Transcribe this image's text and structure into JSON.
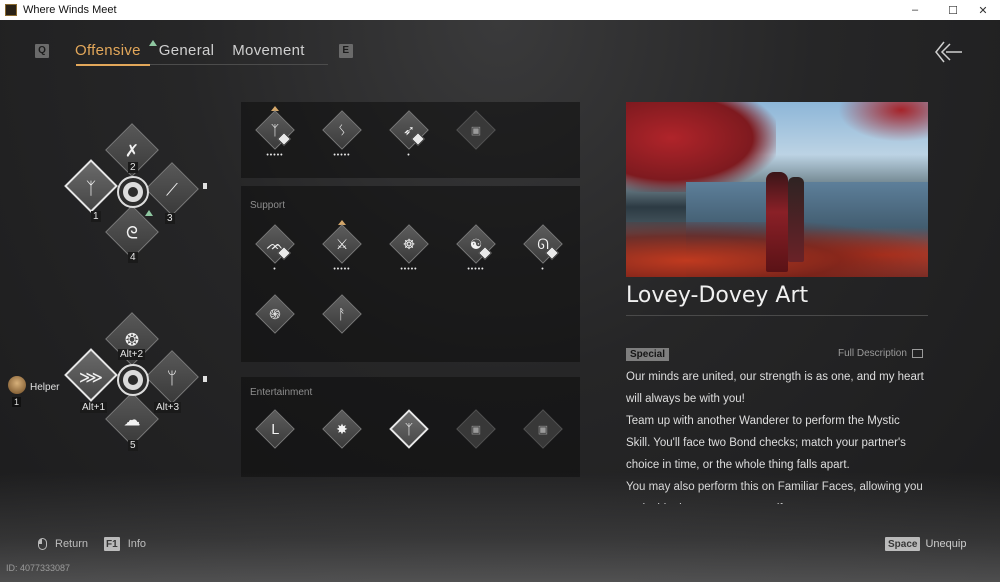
{
  "window": {
    "title": "Where Winds Meet",
    "controls": [
      "–",
      "☐",
      "✕"
    ]
  },
  "tabs": {
    "prev_key": "Q",
    "next_key": "E",
    "items": [
      {
        "label": "Offensive",
        "active": true
      },
      {
        "label": "General",
        "active": false
      },
      {
        "label": "Movement",
        "active": false
      }
    ]
  },
  "wheel_top": {
    "slots": [
      {
        "num": "1",
        "icon": "dance-pose-icon"
      },
      {
        "num": "2",
        "icon": "sword-clash-icon"
      },
      {
        "num": "3",
        "icon": "blade-icon"
      },
      {
        "num": "4",
        "icon": "whirl-icon"
      }
    ]
  },
  "wheel_bottom": {
    "slots": [
      {
        "num": "Alt+1",
        "icon": "feather-icon"
      },
      {
        "num": "Alt+2",
        "icon": "flame-icon"
      },
      {
        "num": "Alt+3",
        "icon": "pose-icon"
      },
      {
        "num": "5",
        "icon": "cloud-icon"
      }
    ]
  },
  "helper": {
    "label": "Helper",
    "key": "1"
  },
  "panels": {
    "offensive": {
      "label": "",
      "skills": [
        {
          "icon": "kick-icon",
          "dots": "•••••",
          "badge": true,
          "cap": true
        },
        {
          "icon": "leap-icon",
          "dots": "•••••",
          "badge": false,
          "cap": false
        },
        {
          "icon": "archer-icon",
          "dots": "•",
          "badge": true,
          "cap": false
        },
        {
          "icon": "locked-icon",
          "dots": "",
          "badge": false,
          "cap": false,
          "locked": true
        }
      ]
    },
    "support": {
      "label": "Support",
      "skills": [
        {
          "icon": "bird-icon",
          "dots": "•",
          "badge": true,
          "cap": false
        },
        {
          "icon": "crossed-swords-icon",
          "dots": "•••••",
          "badge": false,
          "cap": true
        },
        {
          "icon": "meditate-icon",
          "dots": "•••••",
          "badge": false,
          "cap": false
        },
        {
          "icon": "yin-yang-icon",
          "dots": "•••••",
          "badge": true,
          "cap": false
        },
        {
          "icon": "crane-icon",
          "dots": "•",
          "badge": true,
          "cap": false
        },
        {
          "icon": "spiral-icon",
          "dots": "",
          "badge": false,
          "cap": false
        },
        {
          "icon": "staff-icon",
          "dots": "",
          "badge": false,
          "cap": false
        }
      ]
    },
    "entertainment": {
      "label": "Entertainment",
      "skills": [
        {
          "icon": "bow-pose-icon",
          "dots": "",
          "badge": false,
          "cap": false
        },
        {
          "icon": "spin-icon",
          "dots": "",
          "badge": false,
          "cap": false
        },
        {
          "icon": "duo-dance-icon",
          "dots": "",
          "badge": false,
          "cap": false,
          "selected": true
        },
        {
          "icon": "locked-icon",
          "dots": "",
          "badge": false,
          "cap": false,
          "locked": true
        },
        {
          "icon": "locked-icon",
          "dots": "",
          "badge": false,
          "cap": false,
          "locked": true
        }
      ]
    }
  },
  "detail": {
    "title": "Lovey-Dovey Art",
    "tag": "Special",
    "full_description": "Full Description",
    "paragraphs": [
      "Our minds are united, our strength is as one, and my heart will always be with you!",
      "Team up with another Wanderer to perform the Mystic Skill. You'll face two Bond checks; match your partner's choice in time, or the whole thing falls apart.",
      "You may also perform this on Familiar Faces, allowing you to decide the outcome yourself."
    ]
  },
  "footer": {
    "return_label": "Return",
    "info_key": "F1",
    "info_label": "Info",
    "space_key": "Space",
    "unequip_label": "Unequip",
    "uid": "ID: 4077333087"
  },
  "colors": {
    "accent": "#e2a75a",
    "arrow_green": "#8fc7a1"
  }
}
